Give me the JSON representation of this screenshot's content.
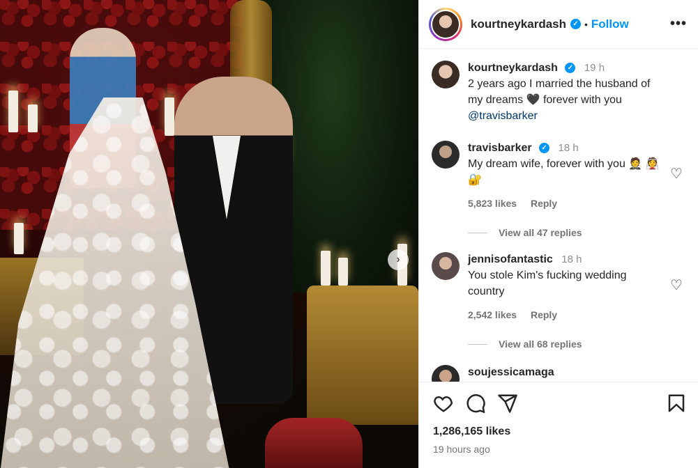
{
  "post": {
    "author": "kourtneykardash",
    "follow_label": "Follow",
    "separator": "•",
    "more_label": "•••",
    "verified_mark": "✓",
    "likes": "1,286,165 likes",
    "posted_ago": "19 hours ago"
  },
  "caption": {
    "user": "kourtneykardash",
    "time": "19 h",
    "text": "2 years ago I married the husband of my dreams 🖤 forever with you",
    "mention": "@travisbarker"
  },
  "comments": [
    {
      "user": "travisbarker",
      "verified": true,
      "time": "18 h",
      "text": "My dream wife, forever with you 🤵 👰🔐",
      "likes": "5,823 likes",
      "reply_label": "Reply",
      "view_replies": "View all 47 replies"
    },
    {
      "user": "jennisofantastic",
      "verified": false,
      "time": "18 h",
      "text": "You stole Kim's fucking wedding country",
      "likes": "2,542 likes",
      "reply_label": "Reply",
      "view_replies": "View all 68 replies"
    },
    {
      "user": "soujessicamaga"
    }
  ],
  "icons": {
    "like": "heart-icon",
    "comment": "comment-icon",
    "share": "share-icon",
    "save": "bookmark-icon",
    "next": "chevron-right-icon",
    "comment_like": "heart-outline-icon"
  },
  "colors": {
    "accent": "#0095f6",
    "text": "#262626",
    "muted": "#737373"
  }
}
